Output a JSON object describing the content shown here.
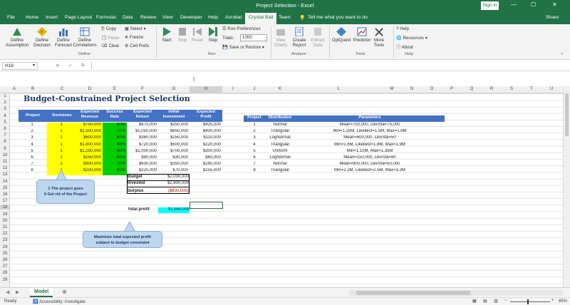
{
  "window": {
    "title": "Project Selection  -  Excel",
    "signin": "Sign in",
    "min": "—",
    "max": "☐",
    "close": "✕"
  },
  "tabs": [
    "File",
    "Home",
    "Insert",
    "Page Layout",
    "Formulas",
    "Data",
    "Review",
    "View",
    "Developer",
    "Help",
    "Acrobat",
    "Crystal Ball",
    "Team"
  ],
  "tell_me": "Tell me what you want to do",
  "share": "Share",
  "ribbon": {
    "define": {
      "assumption": "Define\nAssumption",
      "decision": "Define\nDecision",
      "forecast": "Define\nForecast",
      "correlations": "Define\nCorrelations",
      "copy": "Copy",
      "paste": "Paste",
      "clear": "Clear",
      "select": "Select",
      "freeze": "Freeze",
      "cellprefs": "Cell Prefs",
      "label": "Define"
    },
    "run": {
      "start": "Start",
      "stop": "Stop",
      "reset": "Reset",
      "step": "Step",
      "runprefs": "Run Preferences",
      "trials_label": "Trials:",
      "trials_value": "1000",
      "save": "Save or Restore",
      "label": "Run"
    },
    "analyze": {
      "view": "View\nCharts",
      "create": "Create\nReport",
      "extract": "Extract\nData",
      "label": "Analyze"
    },
    "tools": {
      "optquest": "OptQuest",
      "predictor": "Predictor",
      "more": "More\nTools",
      "label": "Tools"
    },
    "help": {
      "help": "Help",
      "resources": "Resources",
      "about": "About",
      "label": "Help"
    }
  },
  "namebox": "H18",
  "fx": "fx",
  "columns": [
    "A",
    "B",
    "C",
    "D",
    "E",
    "F",
    "G",
    "H",
    "I",
    "J",
    "K",
    "L",
    "M",
    "N",
    "O",
    "P",
    "Q",
    "R",
    "S",
    "T",
    "U"
  ],
  "rows": [
    "1",
    "2",
    "3",
    "4",
    "5",
    "6",
    "7",
    "8",
    "9",
    "10",
    "11",
    "12",
    "13",
    "14",
    "15",
    "16",
    "17",
    "18",
    "19",
    "20",
    "21",
    "22",
    "23",
    "24",
    "25",
    "26",
    "27",
    "28",
    "29"
  ],
  "sheet": {
    "title": "Budget-Constrained Project Selection",
    "headers": [
      "Project",
      "Decisions",
      "Expected\nRevenue",
      "Success\nRate",
      "Expected\nReturn",
      "Initial\nInvestment",
      "Expected\nProfit"
    ],
    "projects": [
      {
        "p": "1",
        "d": "1",
        "rev": "$750,000",
        "rate": "90%",
        "ret": "$675,000",
        "inv": "$250,000",
        "prof": "$425,000"
      },
      {
        "p": "2",
        "d": "1",
        "rev": "$1,500,000",
        "rate": "70%",
        "ret": "$1,050,000",
        "inv": "$650,000",
        "prof": "$400,000"
      },
      {
        "p": "3",
        "d": "1",
        "rev": "$600,000",
        "rate": "60%",
        "ret": "$360,000",
        "inv": "$250,000",
        "prof": "$110,000"
      },
      {
        "p": "4",
        "d": "1",
        "rev": "$1,800,000",
        "rate": "40%",
        "ret": "$720,000",
        "inv": "$500,000",
        "prof": "$220,000"
      },
      {
        "p": "5",
        "d": "1",
        "rev": "$1,250,000",
        "rate": "80%",
        "ret": "$1,000,000",
        "inv": "$700,000",
        "prof": "$300,000"
      },
      {
        "p": "6",
        "d": "1",
        "rev": "$150,000",
        "rate": "60%",
        "ret": "$90,000",
        "inv": "$30,000",
        "prof": "$60,000"
      },
      {
        "p": "7",
        "d": "1",
        "rev": "$900,000",
        "rate": "70%",
        "ret": "$630,000",
        "inv": "$350,000",
        "prof": "$280,000"
      },
      {
        "p": "8",
        "d": "1",
        "rev": "$250,000",
        "rate": "90%",
        "ret": "$225,000",
        "inv": "$70,000",
        "prof": "$155,000"
      }
    ],
    "dist_headers": [
      "Project",
      "Distribution",
      "Parameters"
    ],
    "dists": [
      {
        "p": "1",
        "dist": "Normal",
        "param": "Mean=750,000, DevSta=75,000"
      },
      {
        "p": "2",
        "dist": "Triangular",
        "param": "Min=1.25M, Likeliest=1.5M, Max=1.6M"
      },
      {
        "p": "3",
        "dist": "LogNormal",
        "param": "Mean=600,000, DevSta=50"
      },
      {
        "p": "4",
        "dist": "Triangular",
        "param": "Min=1.6M, Likeliest=1.8M, Max=1.9M"
      },
      {
        "p": "5",
        "dist": "Uniform",
        "param": "Min=1.15M, Max=1.35M"
      },
      {
        "p": "6",
        "dist": "LogNormal",
        "param": "Mean=150,000, DevSta=80"
      },
      {
        "p": "7",
        "dist": "Normal",
        "param": "Mean=900,000, DevSta=50,000"
      },
      {
        "p": "8",
        "dist": "Triangular",
        "param": "Min=2.2M, Likeliest=2.5M, Max=3.2M"
      }
    ],
    "budget_label": "Budget",
    "budget": "$2,000,000",
    "invested_label": "Invested",
    "invested": "$2,800,000",
    "surplus_label": "Surplus",
    "surplus": "($800,000)",
    "total_label": "Total profit",
    "total": "$1,950,000",
    "callout1": "1 The project goes\n0 Get rid of the Project",
    "callout2": "Maximize total expected profit\nsubject to budget constraint"
  },
  "sheet_tab": "Model",
  "status": {
    "ready": "Ready",
    "accessibility": "Accessibility: Investigate",
    "zoom": "85%"
  }
}
